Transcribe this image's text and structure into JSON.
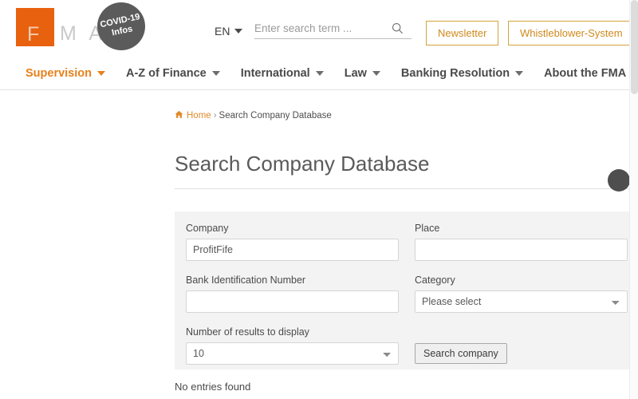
{
  "header": {
    "logo": {
      "square_letter": "F",
      "rest_letters": "M A",
      "name": "FMA"
    },
    "covid_badge": {
      "line1": "COVID-19",
      "line2": "Infos"
    },
    "language": {
      "value": "EN"
    },
    "search": {
      "placeholder": "Enter search term ...",
      "value": "",
      "icon": "search-icon"
    },
    "buttons": [
      {
        "label": "Newsletter"
      },
      {
        "label": "Whistleblower-System"
      }
    ],
    "accent_color": "#e8610f",
    "button_border_color": "#d3a43c",
    "button_text_color": "#d08a1c"
  },
  "nav": {
    "items": [
      {
        "label": "Supervision",
        "active": true
      },
      {
        "label": "A-Z of Finance",
        "active": false
      },
      {
        "label": "International",
        "active": false
      },
      {
        "label": "Law",
        "active": false
      },
      {
        "label": "Banking Resolution",
        "active": false
      },
      {
        "label": "About the FMA",
        "active": false
      }
    ]
  },
  "breadcrumb": {
    "home_label": "Home",
    "separator": "›",
    "current": "Search Company Database"
  },
  "page": {
    "title": "Search Company Database",
    "no_results_text": "No entries found"
  },
  "form": {
    "company": {
      "label": "Company",
      "value": "ProfitFife",
      "placeholder": ""
    },
    "place": {
      "label": "Place",
      "value": "",
      "placeholder": ""
    },
    "bank_identification_number": {
      "label": "Bank Identification Number",
      "value": "",
      "placeholder": ""
    },
    "category": {
      "label": "Category",
      "selected": "Please select"
    },
    "number_of_results": {
      "label": "Number of results to display",
      "selected": "10"
    },
    "submit": {
      "label": "Search company"
    }
  }
}
